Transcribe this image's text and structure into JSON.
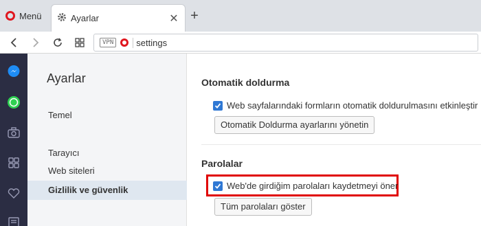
{
  "tabbar": {
    "menu_label": "Menü",
    "tab_title": "Ayarlar",
    "new_tab_symbol": "+"
  },
  "addressbar": {
    "vpn_label": "VPN",
    "url": "settings"
  },
  "sidebar": {
    "icons": [
      "messenger-icon",
      "whatsapp-icon",
      "camera-icon",
      "speed-dial-icon",
      "heart-icon",
      "news-icon"
    ]
  },
  "settings_nav": {
    "heading": "Ayarlar",
    "items": [
      {
        "label": "Temel"
      },
      {
        "label": "Tarayıcı"
      },
      {
        "label": "Web siteleri"
      },
      {
        "label": "Gizlilik ve güvenlik",
        "active": true
      }
    ]
  },
  "main": {
    "autofill": {
      "title": "Otomatik doldurma",
      "checkbox_label": "Web sayfalarındaki formların otomatik doldurulmasını etkinleştir",
      "checked": true,
      "button_label": "Otomatik Doldurma ayarlarını yönetin"
    },
    "passwords": {
      "title": "Parolalar",
      "checkbox_label": "Web'de girdiğim parolaları kaydetmeyi öner",
      "checked": true,
      "button_label": "Tüm parolaları göster"
    }
  },
  "colors": {
    "accent": "#2f78d4",
    "sidebar_bg": "#2b2d43",
    "highlight": "#e00000",
    "opera_red": "#e0171f"
  }
}
